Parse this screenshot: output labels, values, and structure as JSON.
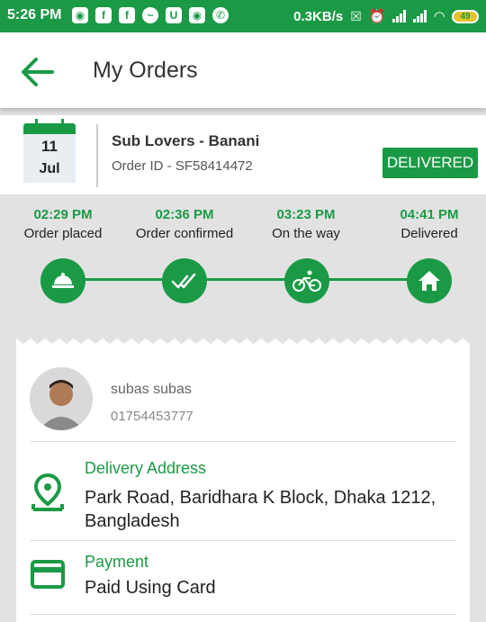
{
  "status_bar": {
    "time": "5:26 PM",
    "speed": "0.3KB/s",
    "battery": "49",
    "app_icons": [
      "messenger-lite-icon",
      "facebook-icon",
      "facebook-icon",
      "messenger-icon",
      "u-icon",
      "messenger-lite-icon",
      "whatsapp-icon"
    ]
  },
  "header": {
    "title": "My Orders"
  },
  "order": {
    "day": "11",
    "month": "Jul",
    "restaurant": "Sub Lovers - Banani",
    "order_id": "Order ID - SF58414472",
    "status": "DELIVERED"
  },
  "timeline": [
    {
      "time": "02:29 PM",
      "label": "Order placed",
      "icon": "cloche-icon"
    },
    {
      "time": "02:36 PM",
      "label": "Order confirmed",
      "icon": "double-check-icon"
    },
    {
      "time": "03:23 PM",
      "label": "On the way",
      "icon": "bicycle-icon"
    },
    {
      "time": "04:41 PM",
      "label": "Delivered",
      "icon": "home-icon"
    }
  ],
  "customer": {
    "name": "subas subas",
    "phone": "01754453777"
  },
  "delivery": {
    "title": "Delivery Address",
    "address": "Park Road, Baridhara K Block, Dhaka 1212, Bangladesh"
  },
  "payment": {
    "title": "Payment",
    "method": "Paid Using Card"
  },
  "colors": {
    "brand": "#1b9a46",
    "background": "#e2e2e2"
  }
}
